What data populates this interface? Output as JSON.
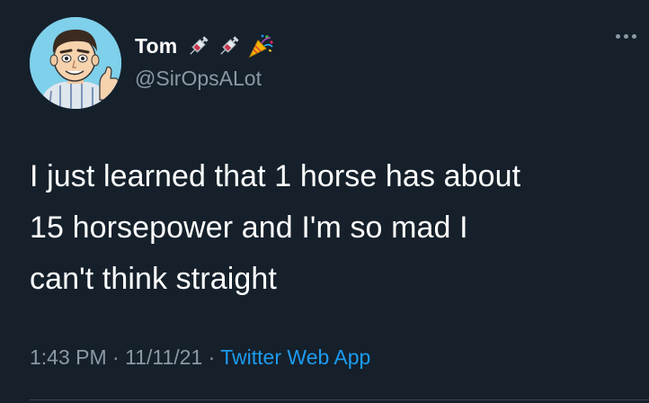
{
  "user": {
    "display_name": "Tom",
    "handle": "@SirOpsALot",
    "avatar_icon": "cartoon-man-thumbs-up-avatar",
    "name_emojis": [
      "syringe-icon",
      "syringe-icon",
      "party-popper-icon"
    ]
  },
  "tweet": {
    "lines": [
      "I just learned that 1 horse has about",
      "15 horsepower and I'm so mad I",
      "can't think straight"
    ]
  },
  "meta": {
    "time": "1:43 PM",
    "separator": "·",
    "date": "11/11/21",
    "source": "Twitter Web App"
  },
  "more_icon": "more-horizontal-icon",
  "colors": {
    "background": "#15202b",
    "primary_text": "#ffffff",
    "secondary_text": "#8b98a5",
    "link": "#1d9bf0",
    "divider": "#38444d"
  }
}
